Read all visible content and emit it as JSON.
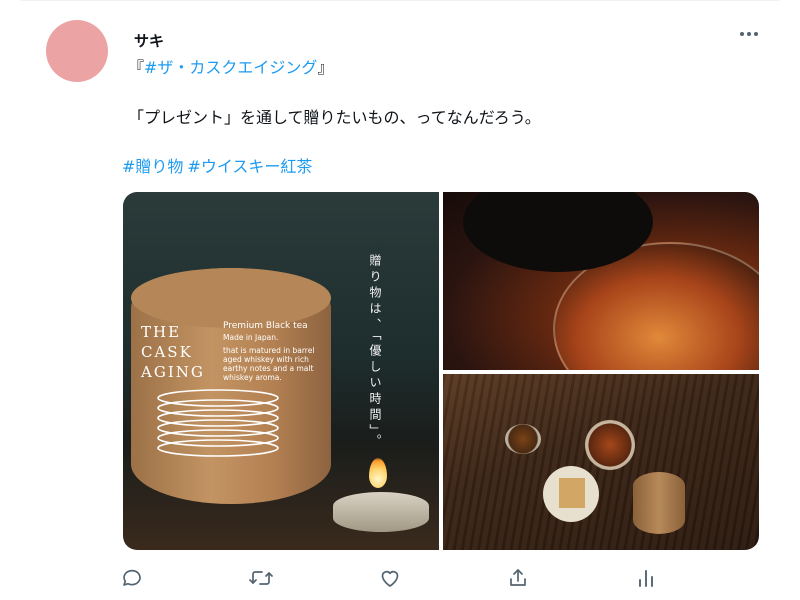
{
  "tweet": {
    "author_name": "サキ",
    "line1_prefix": "『",
    "line1_hashtag": "#ザ・カスクエイジング",
    "line1_suffix": "』",
    "body": "「プレゼント」を通して贈りたいもの、ってなんだろう。",
    "hashtags": [
      "#贈り物",
      "#ウイスキー紅茶"
    ],
    "avatar_color": "#eba3a3",
    "link_color": "#1d9bf0"
  },
  "media": {
    "main": {
      "can_brand_lines": [
        "THE",
        "CASK",
        "AGING"
      ],
      "can_product": "Premium Black tea",
      "can_made_in": "Made in Japan.",
      "can_description": "that is matured in barrel aged whiskey with rich earthy notes and a malt whiskey aroma.",
      "vertical_copy": "贈り物は、「優しい時間」。"
    }
  },
  "actions": {
    "icons": [
      "reply-icon",
      "retweet-icon",
      "like-icon",
      "share-icon",
      "analytics-icon"
    ]
  }
}
